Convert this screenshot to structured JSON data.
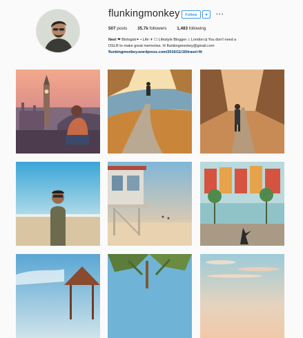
{
  "profile": {
    "username": "flunkingmonkey",
    "follow_label": "Follow",
    "more_label": "•••",
    "stats": {
      "posts_value": "507",
      "posts_label": " posts",
      "followers_value": "35.7k",
      "followers_label": " followers",
      "following_value": "1,483",
      "following_label": " following"
    },
    "bio": {
      "name": "Neel",
      "line1_rest": " ❤ Biologist⚭ • Life ✈ ☐ Lifestyle Blogger ⌂ London ◘ You don't need a",
      "line2": "DSLR to make great memories. ✉ flunkingmonkey@gmail.com",
      "link": "flunkingmonkey.wordpress.com/2016/11/16/travel-fit"
    }
  },
  "posts": [
    {
      "id": 1,
      "subject": "man sitting by Big Ben, London"
    },
    {
      "id": 2,
      "subject": "runner on autumn riverside path"
    },
    {
      "id": 3,
      "subject": "runner on tree-lined lane"
    },
    {
      "id": 4,
      "subject": "man with sunglasses on beach"
    },
    {
      "id": 5,
      "subject": "lifeguard tower on beach"
    },
    {
      "id": 6,
      "subject": "mural wall with palm trees"
    },
    {
      "id": 7,
      "subject": "beach with cabana"
    },
    {
      "id": 8,
      "subject": "palm trees"
    },
    {
      "id": 9,
      "subject": "pastel sunset sky"
    }
  ],
  "colors": {
    "accent": "#3897f0",
    "text": "#262626",
    "background": "#fafafa",
    "link": "#003569"
  }
}
